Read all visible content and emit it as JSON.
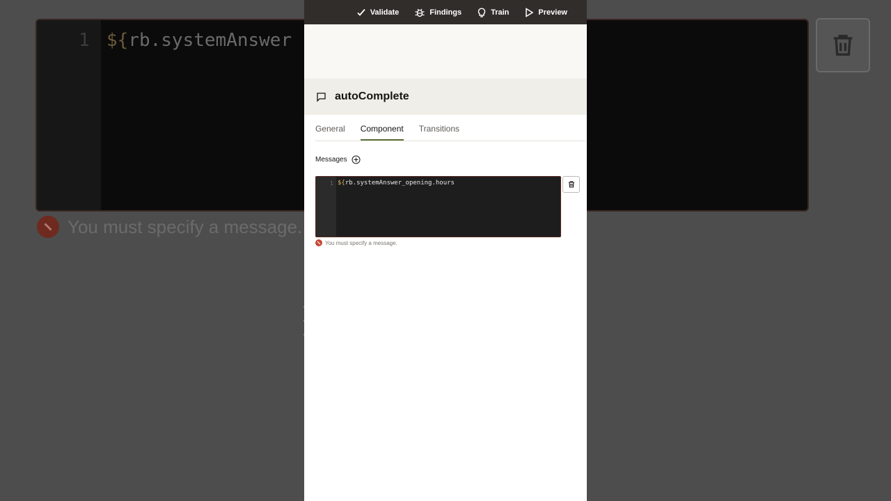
{
  "background": {
    "line_number": "1",
    "code_prefix": "${",
    "code_rest": "rb.systemAnswer",
    "error_text": "You must specify a message."
  },
  "toolbar": {
    "validate_label": "Validate",
    "findings_label": "Findings",
    "train_label": "Train",
    "preview_label": "Preview"
  },
  "state": {
    "title": "autoComplete",
    "tabs": [
      {
        "label": "General",
        "active": false
      },
      {
        "label": "Component",
        "active": true
      },
      {
        "label": "Transitions",
        "active": false
      }
    ]
  },
  "messages": {
    "label": "Messages",
    "editor": {
      "line_number": "1",
      "code_prefix": "${",
      "code_rest": "rb.systemAnswer_opening.hours"
    },
    "error_text": "You must specify a message."
  },
  "colors": {
    "toolbar_bg": "#312d2a",
    "active_tab_underline": "#5b6f3a",
    "error": "#c74634"
  },
  "icons": [
    "check-icon",
    "bug-icon",
    "lightbulb-icon",
    "play-icon",
    "chat-bubble-icon",
    "add-circle-icon",
    "trash-icon",
    "error-icon"
  ]
}
